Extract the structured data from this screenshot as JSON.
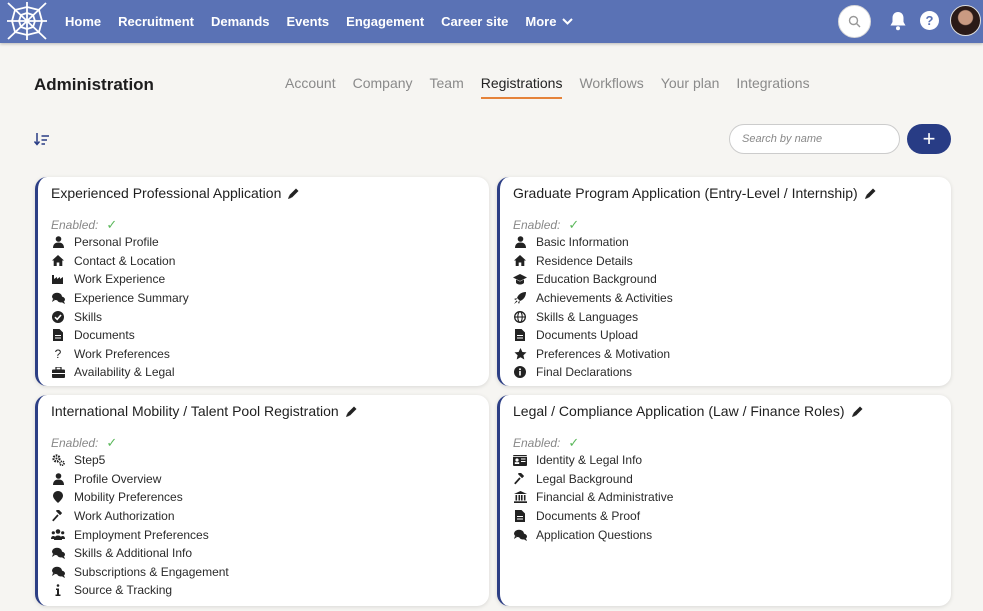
{
  "nav": {
    "items": [
      "Home",
      "Recruitment",
      "Demands",
      "Events",
      "Engagement",
      "Career site",
      "More"
    ]
  },
  "header": {
    "title": "Administration",
    "tabs": [
      "Account",
      "Company",
      "Team",
      "Registrations",
      "Workflows",
      "Your plan",
      "Integrations"
    ],
    "active_tab": "Registrations"
  },
  "toolbar": {
    "search_placeholder": "Search by name",
    "add_label": "+"
  },
  "colors": {
    "nav_bg": "#5a72b5",
    "accent": "#e5833a",
    "primary": "#283c85",
    "check": "#5cb85c"
  },
  "cards": [
    {
      "title": "Experienced Professional Application",
      "enabled_label": "Enabled:",
      "steps": [
        {
          "label": "Personal Profile",
          "icon": "user-icon"
        },
        {
          "label": "Contact & Location",
          "icon": "home-icon"
        },
        {
          "label": "Work Experience",
          "icon": "industry-icon"
        },
        {
          "label": "Experience Summary",
          "icon": "comments-icon"
        },
        {
          "label": "Skills",
          "icon": "check-circle-icon"
        },
        {
          "label": "Documents",
          "icon": "file-icon"
        },
        {
          "label": "Work Preferences",
          "icon": "question-icon"
        },
        {
          "label": "Availability & Legal",
          "icon": "briefcase-icon"
        }
      ]
    },
    {
      "title": "Graduate Program Application (Entry-Level / Internship)",
      "enabled_label": "Enabled:",
      "steps": [
        {
          "label": "Basic Information",
          "icon": "user-icon"
        },
        {
          "label": "Residence Details",
          "icon": "home-icon"
        },
        {
          "label": "Education Background",
          "icon": "graduation-cap-icon"
        },
        {
          "label": "Achievements & Activities",
          "icon": "rocket-icon"
        },
        {
          "label": "Skills & Languages",
          "icon": "globe-icon"
        },
        {
          "label": "Documents Upload",
          "icon": "file-icon"
        },
        {
          "label": "Preferences & Motivation",
          "icon": "star-icon"
        },
        {
          "label": "Final Declarations",
          "icon": "info-circle-icon"
        }
      ]
    },
    {
      "title": "International Mobility / Talent Pool Registration",
      "enabled_label": "Enabled:",
      "steps": [
        {
          "label": "Step5",
          "icon": "cogs-icon"
        },
        {
          "label": "Profile Overview",
          "icon": "user-icon"
        },
        {
          "label": "Mobility Preferences",
          "icon": "map-marker-icon"
        },
        {
          "label": "Work Authorization",
          "icon": "gavel-icon"
        },
        {
          "label": "Employment Preferences",
          "icon": "users-icon"
        },
        {
          "label": "Skills & Additional Info",
          "icon": "comments-icon"
        },
        {
          "label": "Subscriptions & Engagement",
          "icon": "comments-icon"
        },
        {
          "label": "Source & Tracking",
          "icon": "info-icon"
        }
      ]
    },
    {
      "title": "Legal / Compliance Application (Law / Finance Roles)",
      "enabled_label": "Enabled:",
      "steps": [
        {
          "label": "Identity & Legal Info",
          "icon": "id-card-icon"
        },
        {
          "label": "Legal Background",
          "icon": "gavel-icon"
        },
        {
          "label": "Financial & Administrative",
          "icon": "bank-icon"
        },
        {
          "label": "Documents & Proof",
          "icon": "file-icon"
        },
        {
          "label": "Application Questions",
          "icon": "comments-icon"
        }
      ]
    }
  ]
}
